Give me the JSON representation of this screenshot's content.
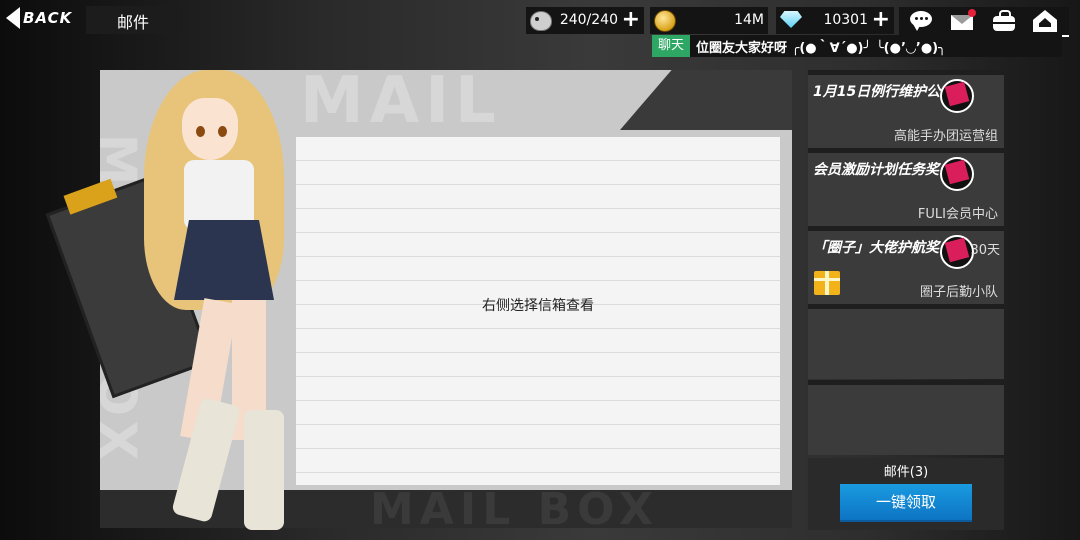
{
  "header": {
    "back_label": "BACK",
    "title": "邮件"
  },
  "resources": {
    "stamina": {
      "icon": "hedgehog-icon",
      "value": "240/240",
      "plus": "+"
    },
    "coins": {
      "icon": "coin-icon",
      "value": "14M",
      "plus": ""
    },
    "gems": {
      "icon": "diamond-icon",
      "value": "10301",
      "plus": "+"
    }
  },
  "top_icons": [
    "chat-bubble-icon",
    "mail-icon",
    "bag-icon",
    "home-icon"
  ],
  "chat": {
    "label": "聊天",
    "message": "位圈友大家好呀  ╭(●｀∀´●)╯  ╰(●’◡’●)╮"
  },
  "main": {
    "hint": "右侧选择信箱查看",
    "bg_text_top": "MAIL",
    "bg_text_side": "MAIL BOX",
    "bg_text_bottom": "MAIL BOX"
  },
  "mail_list": [
    {
      "subject": "1月15日例行维护公",
      "sender": "高能手办团运营组",
      "is_new": true,
      "extra": "",
      "gift": false
    },
    {
      "subject": "会员激励计划任务奖",
      "sender": "FULI会员中心",
      "is_new": true,
      "extra": "",
      "gift": false
    },
    {
      "subject": "「圈子」大佬护航奖",
      "sender": "圈子后勤小队",
      "is_new": true,
      "extra": "30天",
      "gift": true
    }
  ],
  "footer": {
    "count_label": "邮件(3)",
    "claim_label": "一键领取"
  },
  "colors": {
    "chat_green": "#2fa764",
    "claim_blue": "#1a9be0",
    "badge_pink": "#d91e5b",
    "notify_red": "#e6223a"
  }
}
